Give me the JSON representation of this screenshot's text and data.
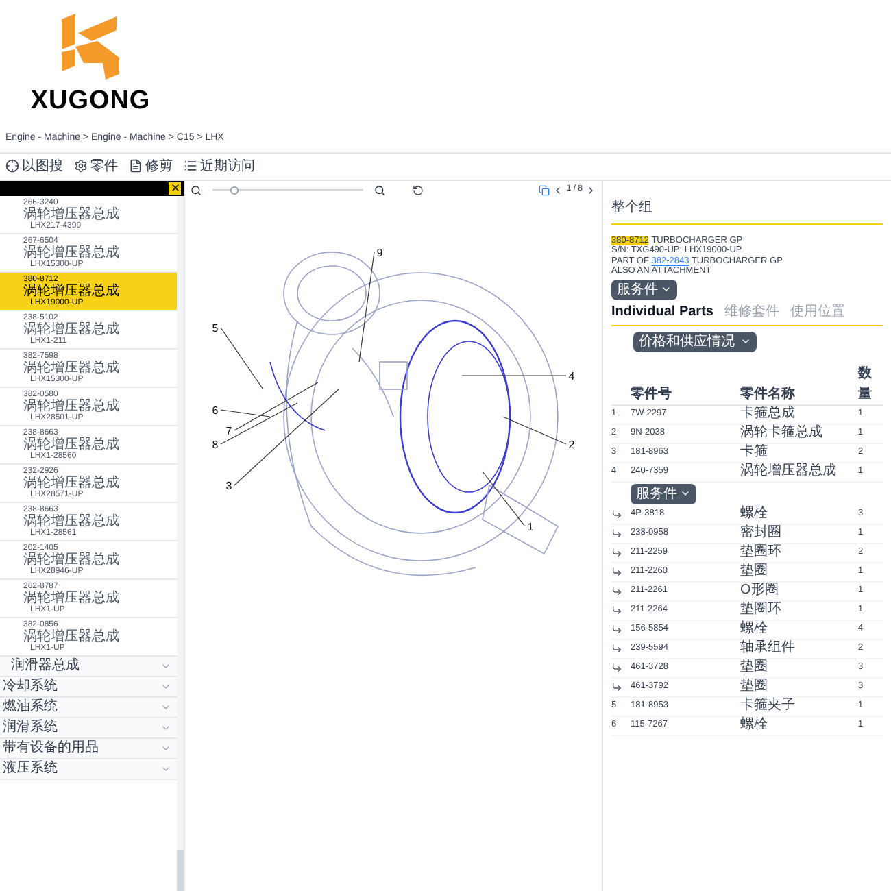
{
  "logo": {
    "text": "XUGONG"
  },
  "breadcrumb": "Engine - Machine > Engine - Machine > C15 > LHX",
  "toolbar": [
    {
      "kind": "target",
      "label": "以图搜"
    },
    {
      "kind": "gear",
      "label": "零件"
    },
    {
      "kind": "doc",
      "label": "修剪"
    },
    {
      "kind": "list",
      "label": "近期访问"
    }
  ],
  "parts_list": {
    "items": [
      {
        "part_number": "266-3240",
        "name": "涡轮增压器总成",
        "serial": "LHX217-4399",
        "selected": false
      },
      {
        "part_number": "267-6504",
        "name": "涡轮增压器总成",
        "serial": "LHX15300-UP",
        "selected": false
      },
      {
        "part_number": "380-8712",
        "name": "涡轮增压器总成",
        "serial": "LHX19000-UP",
        "selected": true
      },
      {
        "part_number": "238-5102",
        "name": "涡轮增压器总成",
        "serial": "LHX1-211",
        "selected": false
      },
      {
        "part_number": "382-7598",
        "name": "涡轮增压器总成",
        "serial": "LHX15300-UP",
        "selected": false
      },
      {
        "part_number": "382-0580",
        "name": "涡轮增压器总成",
        "serial": "LHX28501-UP",
        "selected": false
      },
      {
        "part_number": "238-8663",
        "name": "涡轮增压器总成",
        "serial": "LHX1-28560",
        "selected": false
      },
      {
        "part_number": "232-2926",
        "name": "涡轮增压器总成",
        "serial": "LHX28571-UP",
        "selected": false
      },
      {
        "part_number": "238-8663",
        "name": "涡轮增压器总成",
        "serial": "LHX1-28561",
        "selected": false
      },
      {
        "part_number": "202-1405",
        "name": "涡轮增压器总成",
        "serial": "LHX28946-UP",
        "selected": false
      },
      {
        "part_number": "262-8787",
        "name": "涡轮增压器总成",
        "serial": "LHX1-UP",
        "selected": false
      },
      {
        "part_number": "382-0856",
        "name": "涡轮增压器总成",
        "serial": "LHX1-UP",
        "selected": false
      }
    ],
    "categories": [
      {
        "label": "润滑器总成",
        "indent": true
      },
      {
        "label": "冷却系统",
        "indent": false
      },
      {
        "label": "燃油系统",
        "indent": false
      },
      {
        "label": "润滑系统",
        "indent": false
      },
      {
        "label": "带有设备的用品",
        "indent": false
      },
      {
        "label": "液压系统",
        "indent": false
      }
    ]
  },
  "viewer": {
    "zoom": {
      "level": 0.12
    },
    "page": "1 / 8",
    "callouts": [
      "1",
      "2",
      "3",
      "4",
      "5",
      "6",
      "7",
      "8",
      "9"
    ]
  },
  "details": {
    "title": "整个组",
    "part_number": "380-8712",
    "part_name": "TURBOCHARGER GP",
    "serial": "S/N: TXG490-UP; LHX19000-UP",
    "part_of_prefix": "PART OF",
    "part_of_link": "382-2843",
    "part_of_name": "TURBOCHARGER GP",
    "note": "ALSO AN ATTACHMENT",
    "service_button": "服务件",
    "tabs": [
      {
        "label": "Individual Parts",
        "selected": true
      },
      {
        "label": "维修套件",
        "selected": false
      },
      {
        "label": "使用位置",
        "selected": false
      }
    ],
    "price_button": "价格和供应情况",
    "columns": [
      "零件号",
      "零件名称",
      "数量"
    ],
    "rows": [
      {
        "kind": "part",
        "index": "1",
        "part_number": "7W-2297",
        "name": "卡箍总成",
        "qty": "1"
      },
      {
        "kind": "part",
        "index": "2",
        "part_number": "9N-2038",
        "name": "涡轮卡箍总成",
        "qty": "1"
      },
      {
        "kind": "part",
        "index": "3",
        "part_number": "181-8963",
        "name": "卡箍",
        "qty": "2"
      },
      {
        "kind": "part",
        "index": "4",
        "part_number": "240-7359",
        "name": "涡轮增压器总成",
        "qty": "1"
      },
      {
        "kind": "button",
        "label": "服务件"
      },
      {
        "kind": "child",
        "part_number": "4P-3818",
        "name": "螺栓",
        "qty": "3"
      },
      {
        "kind": "child",
        "part_number": "238-0958",
        "name": "密封圈",
        "qty": "1"
      },
      {
        "kind": "child",
        "part_number": "211-2259",
        "name": "垫圈环",
        "qty": "2"
      },
      {
        "kind": "child",
        "part_number": "211-2260",
        "name": "垫圈",
        "qty": "1"
      },
      {
        "kind": "child",
        "part_number": "211-2261",
        "name": "O形圈",
        "qty": "1"
      },
      {
        "kind": "child",
        "part_number": "211-2264",
        "name": "垫圈环",
        "qty": "1"
      },
      {
        "kind": "child",
        "part_number": "156-5854",
        "name": "螺栓",
        "qty": "4"
      },
      {
        "kind": "child",
        "part_number": "239-5594",
        "name": "轴承组件",
        "qty": "2"
      },
      {
        "kind": "child",
        "part_number": "461-3728",
        "name": "垫圈",
        "qty": "3"
      },
      {
        "kind": "child",
        "part_number": "461-3792",
        "name": "垫圈",
        "qty": "3"
      },
      {
        "kind": "part",
        "index": "5",
        "part_number": "181-8953",
        "name": "卡箍夹子",
        "qty": "1"
      },
      {
        "kind": "part",
        "index": "6",
        "part_number": "115-7267",
        "name": "螺栓",
        "qty": "1"
      }
    ]
  }
}
